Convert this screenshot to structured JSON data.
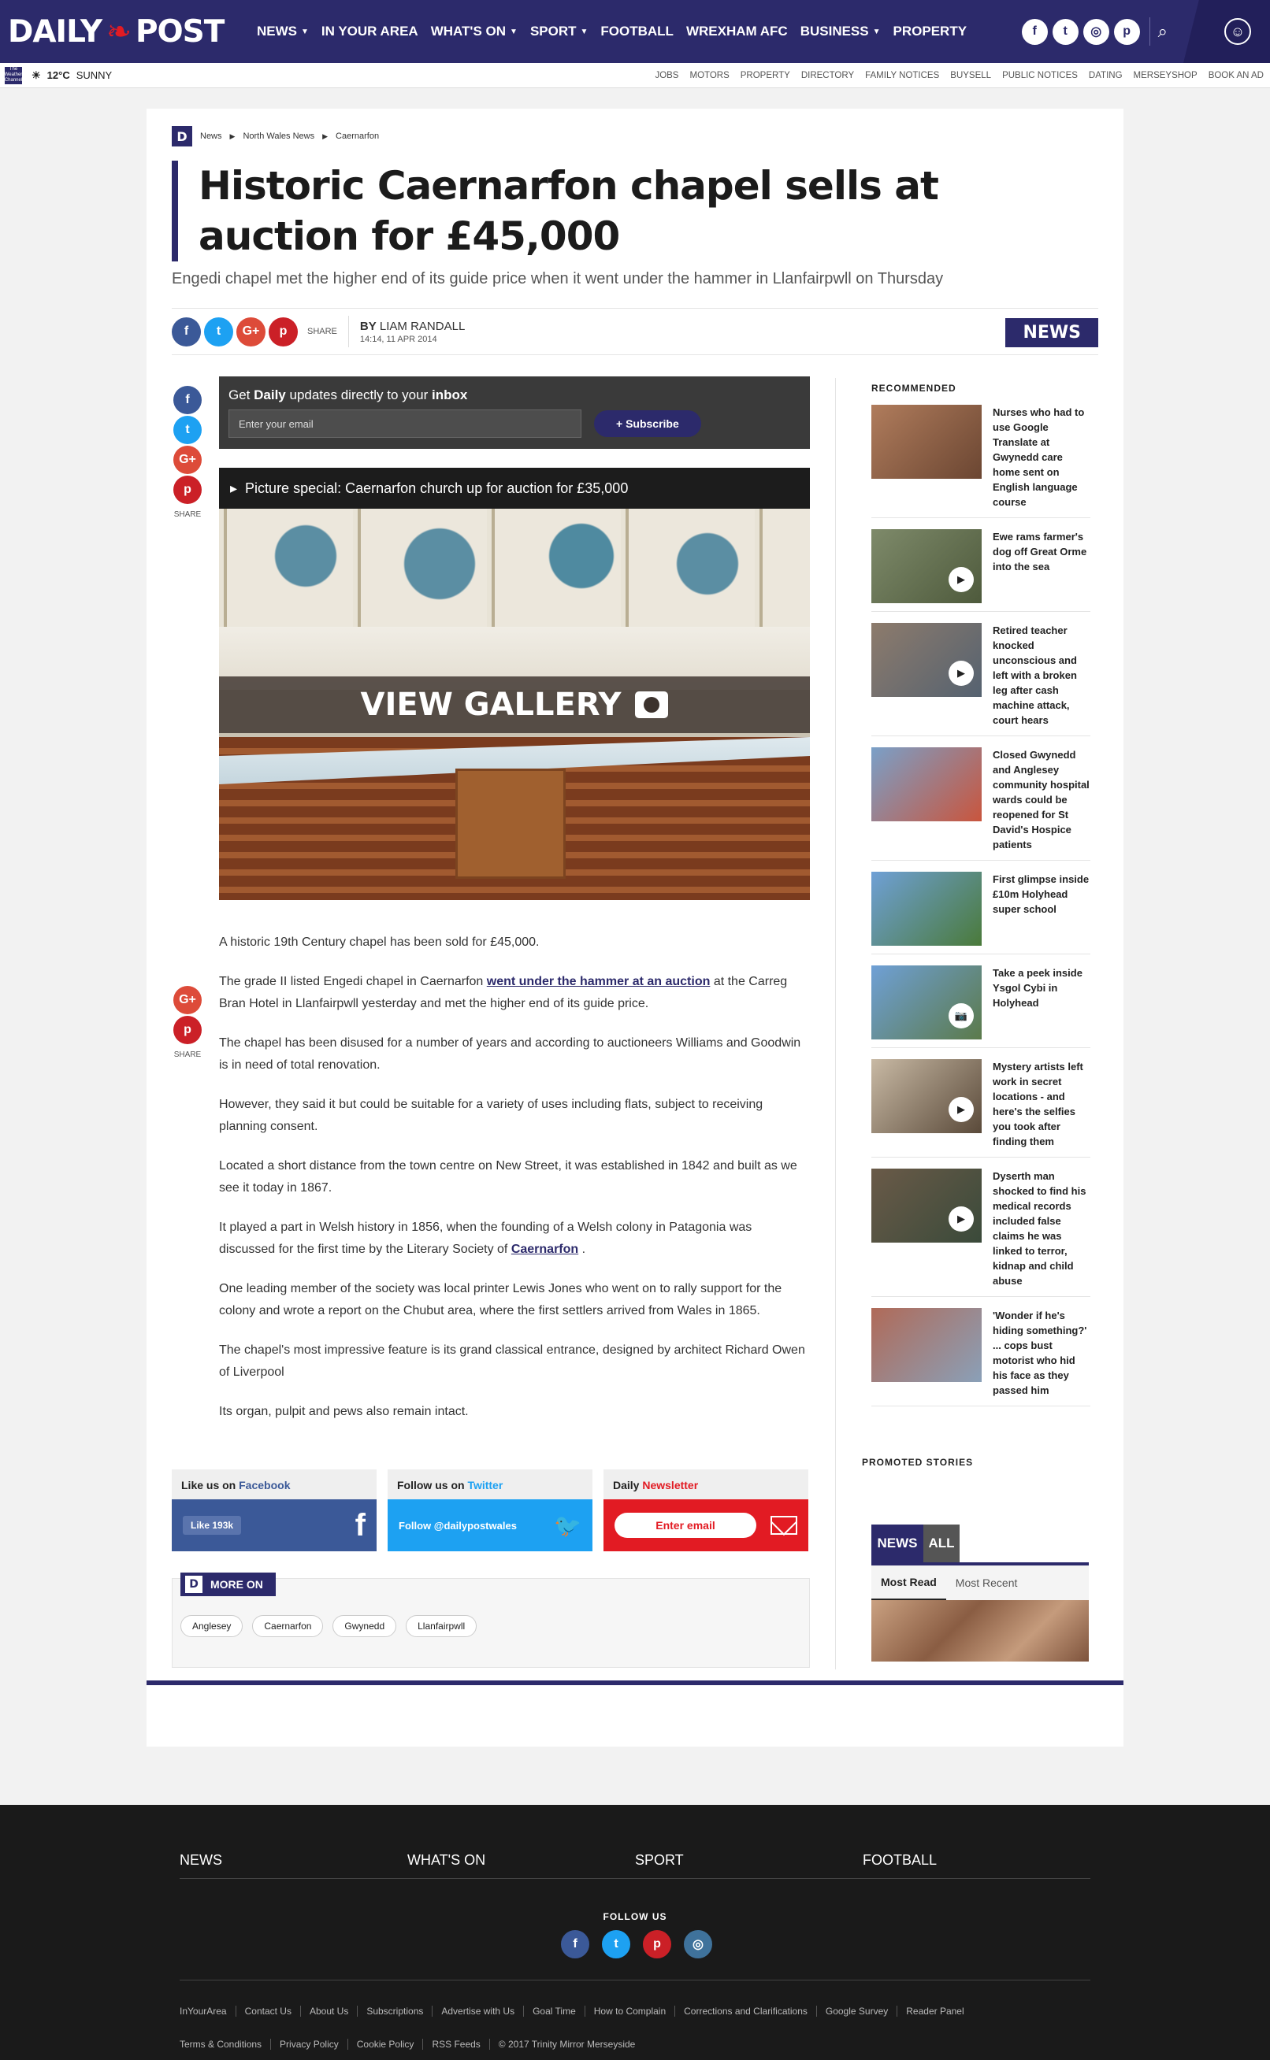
{
  "brand": {
    "name_left": "DAILY",
    "name_right": "POST"
  },
  "nav": {
    "items": [
      {
        "label": "NEWS",
        "caret": true
      },
      {
        "label": "IN YOUR AREA",
        "caret": false
      },
      {
        "label": "WHAT'S ON",
        "caret": true
      },
      {
        "label": "SPORT",
        "caret": true
      },
      {
        "label": "FOOTBALL",
        "caret": false
      },
      {
        "label": "WREXHAM AFC",
        "caret": false
      },
      {
        "label": "BUSINESS",
        "caret": true
      },
      {
        "label": "PROPERTY",
        "caret": false
      }
    ]
  },
  "subbar": {
    "badge": "The Weather Channel",
    "temp": "12°C",
    "condition": "SUNNY",
    "links": [
      "JOBS",
      "MOTORS",
      "PROPERTY",
      "DIRECTORY",
      "FAMILY NOTICES",
      "BUYSELL",
      "PUBLIC NOTICES",
      "DATING",
      "MERSEYSHOP",
      "BOOK AN AD"
    ]
  },
  "breadcrumb": [
    "News",
    "North Wales News",
    "Caernarfon"
  ],
  "article": {
    "headline": "Historic Caernarfon chapel sells at auction for £45,000",
    "standfirst": "Engedi chapel met the higher end of its guide price when it went under the hammer in Llanfairpwll on Thursday",
    "share_label": "SHARE",
    "by_prefix": "BY",
    "author": "LIAM RANDALL",
    "date": "14:14, 11 APR 2014",
    "section_badge": "NEWS",
    "subscribe": {
      "pre": "Get ",
      "bold1": "Daily",
      "mid": " updates directly to your ",
      "bold2": "inbox",
      "placeholder": "Enter your email",
      "button": "+ Subscribe"
    },
    "gallery": {
      "title": "Picture special: Caernarfon church up for auction for £35,000",
      "overlay": "VIEW GALLERY"
    },
    "paragraphs": [
      {
        "text": "A historic 19th Century chapel has been sold for £45,000."
      },
      {
        "pre": "The grade II listed Engedi chapel in Caernarfon ",
        "link": "went under the hammer at an auction",
        "post": " at the Carreg Bran Hotel in Llanfairpwll yesterday and met the higher end of its guide price."
      },
      {
        "text": "The chapel has been disused for a number of years and according to auctioneers Williams and Goodwin is in need of total renovation."
      },
      {
        "text": "However, they said it but could be suitable for a variety of uses including flats, subject to receiving planning consent."
      },
      {
        "text": "Located a short distance from the town centre on New Street, it was established in 1842 and built as we see it today in 1867."
      },
      {
        "pre": "It played a part in Welsh history in 1856, when the founding of a Welsh colony in Patagonia was discussed for the first time by the Literary Society of ",
        "link": "Caernarfon",
        "post": " ."
      },
      {
        "text": "One leading member of the society was local printer Lewis Jones who went on to rally support for the colony and wrote a report on the Chubut area, where the first settlers arrived from Wales in 1865."
      },
      {
        "text": "The chapel's most impressive feature is its grand classical entrance, designed by architect Richard Owen of Liverpool"
      },
      {
        "text": "Its organ, pulpit and pews also remain intact."
      }
    ]
  },
  "follow": {
    "facebook": {
      "pre": "Like us on ",
      "name": "Facebook",
      "like": "Like 193k",
      "icon": "f"
    },
    "twitter": {
      "pre": "Follow us on ",
      "name": "Twitter",
      "button": "Follow @dailypostwales"
    },
    "newsletter": {
      "pre": "Daily ",
      "name": "Newsletter",
      "button": "Enter email"
    }
  },
  "more_on": {
    "label": "MORE ON",
    "tags": [
      "Anglesey",
      "Caernarfon",
      "Gwynedd",
      "Llanfairpwll"
    ]
  },
  "recommended": {
    "heading": "RECOMMENDED",
    "items": [
      {
        "title": "Nurses who had to use Google Translate at Gwynedd care home sent on English language course",
        "video": false,
        "gallery": false,
        "colors": [
          "#b07c5c",
          "#6b4632"
        ]
      },
      {
        "title": "Ewe rams farmer's dog off Great Orme into the sea",
        "video": true,
        "gallery": false,
        "colors": [
          "#7e8a6a",
          "#4e5a3c"
        ]
      },
      {
        "title": "Retired teacher knocked unconscious and left with a broken leg after cash machine attack, court hears",
        "video": true,
        "gallery": false,
        "colors": [
          "#8d7b6c",
          "#556270"
        ]
      },
      {
        "title": "Closed Gwynedd and Anglesey community hospital wards could be reopened for St David's Hospice patients",
        "video": false,
        "gallery": false,
        "colors": [
          "#7aa0c8",
          "#c9553d"
        ]
      },
      {
        "title": "First glimpse inside £10m Holyhead super school",
        "video": false,
        "gallery": false,
        "colors": [
          "#6fa0d6",
          "#4a7a3a"
        ]
      },
      {
        "title": "Take a peek inside Ysgol Cybi in Holyhead",
        "video": false,
        "gallery": true,
        "colors": [
          "#6fa0d6",
          "#5b7a4a"
        ]
      },
      {
        "title": "Mystery artists left work in secret locations - and here's the selfies you took after finding them",
        "video": true,
        "gallery": false,
        "colors": [
          "#c8b9a4",
          "#5a4a3a"
        ]
      },
      {
        "title": "Dyserth man shocked to find his medical records included false claims he was linked to terror, kidnap and child abuse",
        "video": true,
        "gallery": false,
        "colors": [
          "#6a5a48",
          "#3a4a3a"
        ]
      },
      {
        "title": "'Wonder if he's hiding something?' ... cops bust motorist who hid his face as they passed him",
        "video": false,
        "gallery": false,
        "colors": [
          "#b06a58",
          "#8aa0b8"
        ]
      }
    ]
  },
  "promoted": {
    "heading": "PROMOTED STORIES"
  },
  "news_tabs": {
    "tab1": "NEWS",
    "tab2": "ALL",
    "sub1": "Most Read",
    "sub2": "Most Recent"
  },
  "footer": {
    "nav": [
      "NEWS",
      "WHAT'S ON",
      "SPORT",
      "FOOTBALL"
    ],
    "follow_us": "FOLLOW US",
    "links": [
      "InYourArea",
      "Contact Us",
      "About Us",
      "Subscriptions",
      "Advertise with Us",
      "Goal Time",
      "How to Complain",
      "Corrections and Clarifications",
      "Google Survey",
      "Reader Panel",
      "Terms & Conditions",
      "Privacy Policy",
      "Cookie Policy",
      "RSS Feeds",
      "© 2017 Trinity Mirror Merseyside"
    ]
  },
  "colors": {
    "brand": "#2c2a6b",
    "facebook": "#3b5998",
    "twitter": "#1da1f2",
    "google": "#dd4b39",
    "pinterest": "#cb2027",
    "instagram": "#3f729b",
    "newsletter": "#e21b23"
  }
}
